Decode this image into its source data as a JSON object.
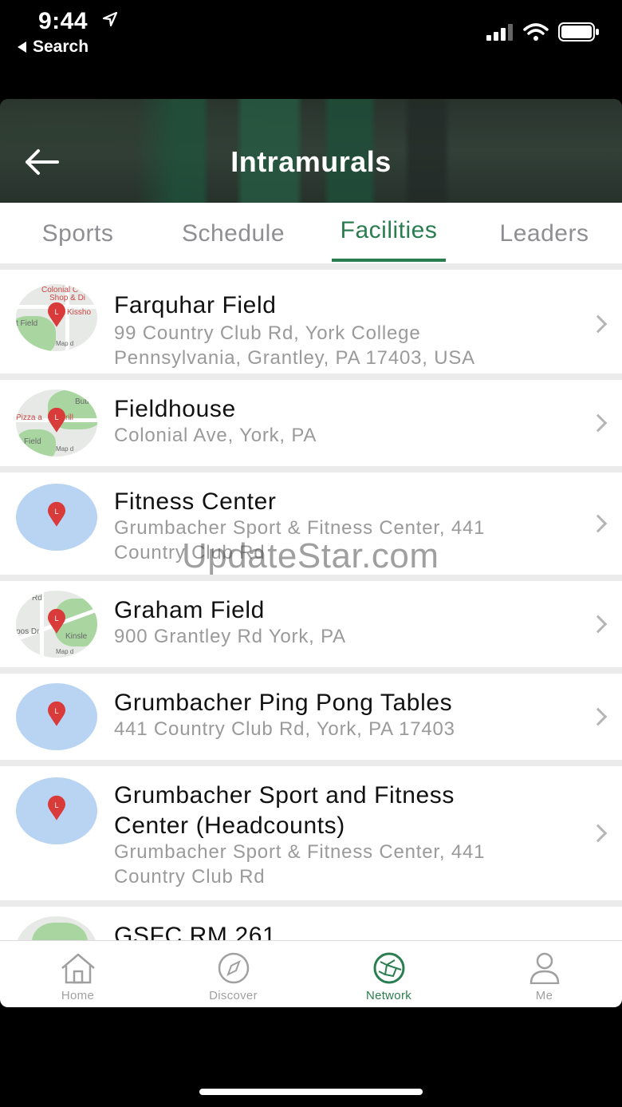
{
  "status": {
    "time": "9:44",
    "back_label": "Search"
  },
  "header": {
    "title": "Intramurals"
  },
  "tabs": [
    {
      "label": "Sports",
      "active": false
    },
    {
      "label": "Schedule",
      "active": false
    },
    {
      "label": "Facilities",
      "active": true
    },
    {
      "label": "Leaders",
      "active": false
    }
  ],
  "facilities": [
    {
      "name": "Farquhar Field",
      "address_line1": "99 Country Club Rd, York College",
      "address_line2": "Pennsylvania, Grantley, PA 17403, USA",
      "thumb": "map",
      "map_labels": [
        "Colonial C",
        "Shop & Di",
        "Kissho",
        "t Field",
        "Map d"
      ]
    },
    {
      "name": "Fieldhouse",
      "address_line1": "Colonial Ave, York, PA",
      "thumb": "map",
      "map_labels": [
        "Butle",
        "Pizza a",
        "rill",
        "Field",
        "Map d"
      ]
    },
    {
      "name": "Fitness Center",
      "address_line1": "Grumbacher Sport & Fitness Center, 441",
      "address_line2": "Country Club Rd",
      "thumb": "blue"
    },
    {
      "name": "Graham Field",
      "address_line1": "900 Grantley Rd York, PA",
      "thumb": "map",
      "map_labels": [
        "Rd",
        "pos Dr",
        "Kinsle",
        "Map d"
      ]
    },
    {
      "name": "Grumbacher Ping Pong Tables",
      "address_line1": "441 Country Club Rd, York, PA 17403",
      "thumb": "blue"
    },
    {
      "name_line1": "Grumbacher Sport and Fitness",
      "name_line2": "Center (Headcounts)",
      "address_line1": "Grumbacher Sport & Fitness Center, 441",
      "address_line2": "Country Club Rd",
      "thumb": "blue"
    },
    {
      "name": "GSFC RM 261",
      "thumb": "map"
    }
  ],
  "watermark": "UpdateStar.com",
  "nav": [
    {
      "label": "Home",
      "icon": "home-icon",
      "active": false
    },
    {
      "label": "Discover",
      "icon": "compass-icon",
      "active": false
    },
    {
      "label": "Network",
      "icon": "network-icon",
      "active": true
    },
    {
      "label": "Me",
      "icon": "person-icon",
      "active": false
    }
  ],
  "colors": {
    "accent": "#2a7d4f",
    "inactive": "#8e8e93",
    "pin": "#d93a3a",
    "blue_thumb": "#b9d4f3"
  }
}
